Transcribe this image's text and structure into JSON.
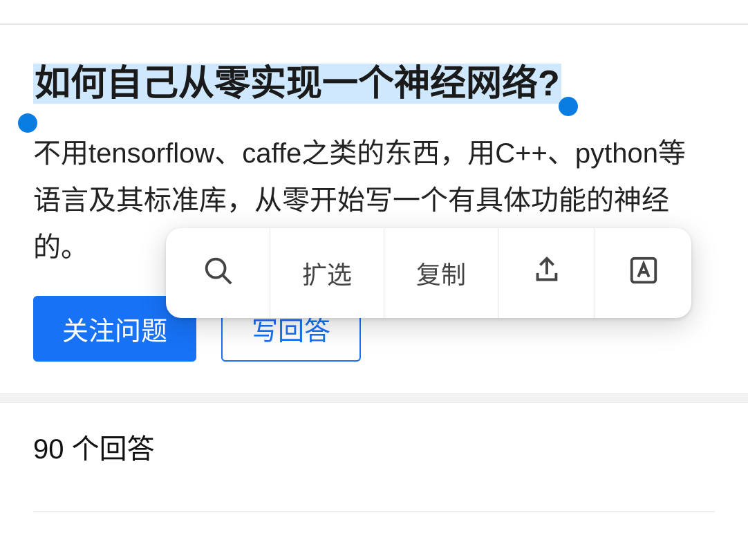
{
  "question": {
    "title": "如何自己从零实现一个神经网络?",
    "description_full": "不用tensorflow、caffe之类的东西，用C++、python等语言及其标准库，从零开始写一个有具体功能的神经网络，譬如识别mnist之类的。",
    "description_prefix": "不用tensorflow、caffe之类的东西，用C++、python等语言及其标准库，从零开始写一个有具体功能的神经",
    "description_suffix": "的。"
  },
  "actions": {
    "follow": "关注问题",
    "answer": "写回答"
  },
  "context_menu": {
    "search": "搜索",
    "expand": "扩选",
    "copy": "复制",
    "share": "分享",
    "translate": "翻译"
  },
  "answers": {
    "count_text": "90 个回答"
  }
}
